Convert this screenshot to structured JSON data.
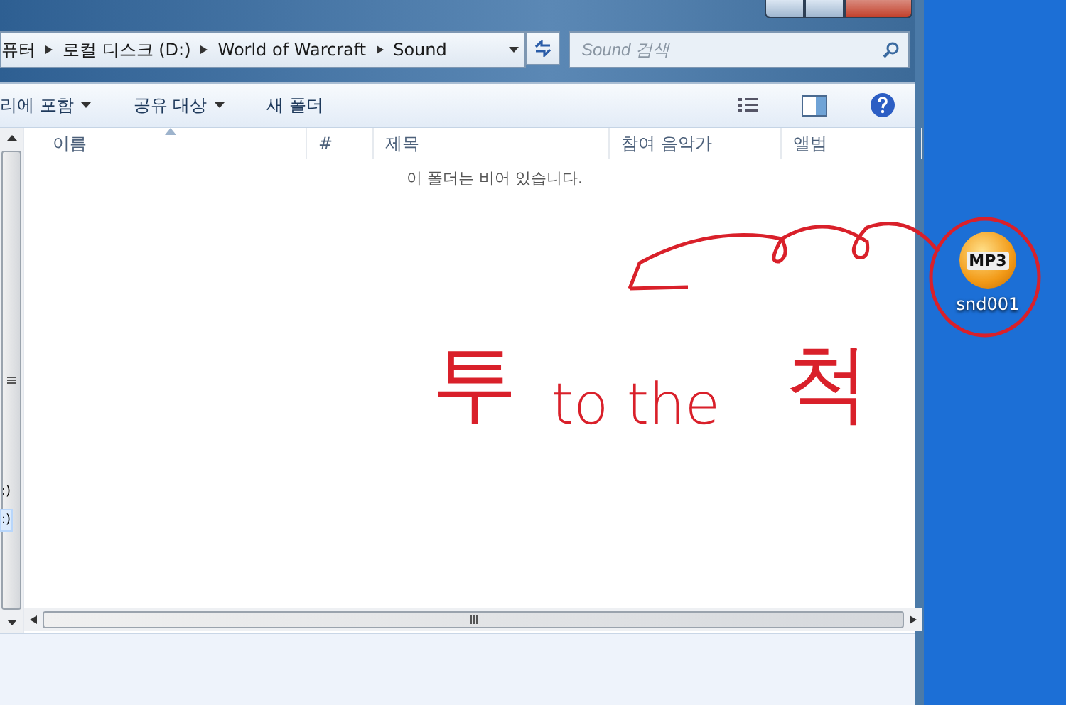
{
  "address_bar": {
    "crumbs": [
      "퓨터",
      "로컬 디스크 (D:)",
      "World of Warcraft",
      "Sound"
    ]
  },
  "search": {
    "placeholder": "Sound 검색"
  },
  "toolbar": {
    "items": [
      {
        "label": "리에 포함",
        "dropdown": true
      },
      {
        "label": "공유 대상",
        "dropdown": true
      },
      {
        "label": "새 폴더",
        "dropdown": false
      }
    ]
  },
  "nav_pane": {
    "items": [
      {
        "label": ":)",
        "selected": false
      },
      {
        "label": ":)",
        "selected": true
      }
    ]
  },
  "table": {
    "columns": [
      {
        "label": "이름",
        "sorted": true
      },
      {
        "label": "#",
        "sorted": false
      },
      {
        "label": "제목",
        "sorted": false
      },
      {
        "label": "참여 음악가",
        "sorted": false
      },
      {
        "label": "앨범",
        "sorted": false
      }
    ],
    "empty_message": "이 폴더는 비어 있습니다."
  },
  "annotation": {
    "text_left": "투",
    "text_middle": "to the",
    "text_right": "척"
  },
  "desktop": {
    "icons": [
      {
        "label": "snd001",
        "badge": "MP3"
      }
    ]
  }
}
